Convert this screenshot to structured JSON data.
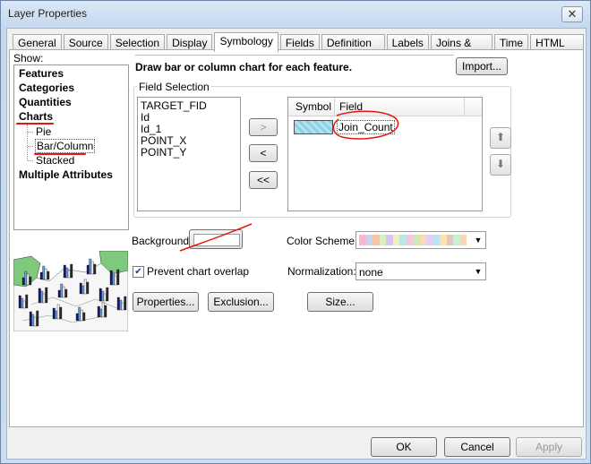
{
  "window": {
    "title": "Layer Properties",
    "close_glyph": "✕"
  },
  "tabs": [
    {
      "label": "General",
      "active": false
    },
    {
      "label": "Source",
      "active": false
    },
    {
      "label": "Selection",
      "active": false
    },
    {
      "label": "Display",
      "active": false
    },
    {
      "label": "Symbology",
      "active": true
    },
    {
      "label": "Fields",
      "active": false
    },
    {
      "label": "Definition Query",
      "active": false
    },
    {
      "label": "Labels",
      "active": false
    },
    {
      "label": "Joins & Relates",
      "active": false
    },
    {
      "label": "Time",
      "active": false
    },
    {
      "label": "HTML Popup",
      "active": false
    }
  ],
  "show": {
    "label": "Show:",
    "categories": [
      "Features",
      "Categories",
      "Quantities",
      "Charts"
    ],
    "chart_types": [
      "Pie",
      "Bar/Column",
      "Stacked"
    ],
    "selected_chart_type": "Bar/Column",
    "last": "Multiple Attributes"
  },
  "description": "Draw bar or column chart for each feature.",
  "import_label": "Import...",
  "field_selection": {
    "label": "Field Selection",
    "available": [
      "TARGET_FID",
      "Id",
      "Id_1",
      "POINT_X",
      "POINT_Y"
    ],
    "add_label": ">",
    "remove_label": "<",
    "remove_all_label": "<<",
    "table_headers": [
      "Symbol",
      "Field"
    ],
    "selected": [
      {
        "field": "Join_Count"
      }
    ]
  },
  "background": {
    "label": "Background:"
  },
  "color_scheme": {
    "label": "Color  Scheme:",
    "swatches": [
      "#f7b6d2",
      "#c5d6f3",
      "#f5c6a6",
      "#d9f0c4",
      "#d7c6ef",
      "#f3f0b8",
      "#b9e8e6",
      "#f6c6e0",
      "#cfe8b4",
      "#fbd9b9",
      "#e3d1f5",
      "#bfe1f5",
      "#f9e6a8",
      "#e8c4c4",
      "#c9efd6",
      "#f5d6b6"
    ]
  },
  "prevent_overlap": {
    "label": "Prevent chart overlap",
    "checked": true
  },
  "normalization": {
    "label": "Normalization:",
    "value": "none"
  },
  "buttons": {
    "properties": "Properties...",
    "exclusion": "Exclusion...",
    "size": "Size..."
  },
  "footer": {
    "ok": "OK",
    "cancel": "Cancel",
    "apply": "Apply"
  },
  "colors": {
    "annotation_red": "#e8150c",
    "titlebar": "#c5d8ee"
  }
}
